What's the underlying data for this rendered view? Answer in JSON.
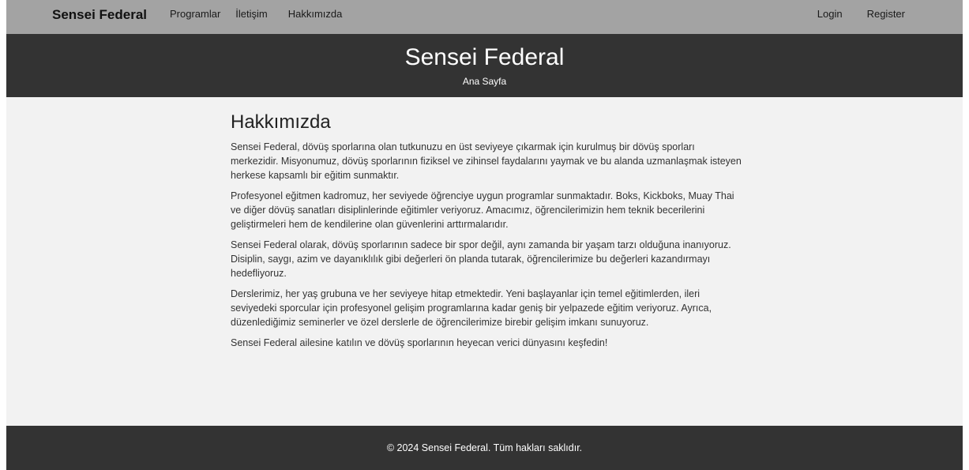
{
  "navbar": {
    "brand": "Sensei Federal",
    "left_links": [
      "Programlar",
      "İletişim",
      "Hakkımızda"
    ],
    "right_links": [
      "Login",
      "Register"
    ]
  },
  "hero": {
    "title": "Sensei Federal",
    "subtitle": "Ana Sayfa"
  },
  "about": {
    "heading": "Hakkımızda",
    "paragraphs": [
      "Sensei Federal, dövüş sporlarına olan tutkunuzu en üst seviyeye çıkarmak için kurulmuş bir dövüş sporları merkezidir. Misyonumuz, dövüş sporlarının fiziksel ve zihinsel faydalarını yaymak ve bu alanda uzmanlaşmak isteyen herkese kapsamlı bir eğitim sunmaktır.",
      "Profesyonel eğitmen kadromuz, her seviyede öğrenciye uygun programlar sunmaktadır. Boks, Kickboks, Muay Thai ve diğer dövüş sanatları disiplinlerinde eğitimler veriyoruz. Amacımız, öğrencilerimizin hem teknik becerilerini geliştirmeleri hem de kendilerine olan güvenlerini arttırmalarıdır.",
      "Sensei Federal olarak, dövüş sporlarının sadece bir spor değil, aynı zamanda bir yaşam tarzı olduğuna inanıyoruz. Disiplin, saygı, azim ve dayanıklılık gibi değerleri ön planda tutarak, öğrencilerimize bu değerleri kazandırmayı hedefliyoruz.",
      "Derslerimiz, her yaş grubuna ve her seviyeye hitap etmektedir. Yeni başlayanlar için temel eğitimlerden, ileri seviyedeki sporcular için profesyonel gelişim programlarına kadar geniş bir yelpazede eğitim veriyoruz. Ayrıca, düzenlediğimiz seminerler ve özel derslerle de öğrencilerimize birebir gelişim imkanı sunuyoruz.",
      "Sensei Federal ailesine katılın ve dövüş sporlarının heyecan verici dünyasını keşfedin!"
    ]
  },
  "footer": {
    "text": "© 2024 Sensei Federal. Tüm hakları saklıdır."
  },
  "colors": {
    "navbar_bg": "#a3a3a3",
    "hero_bg": "#333333",
    "page_bg": "#f2f2f2",
    "footer_bg": "#333333"
  }
}
